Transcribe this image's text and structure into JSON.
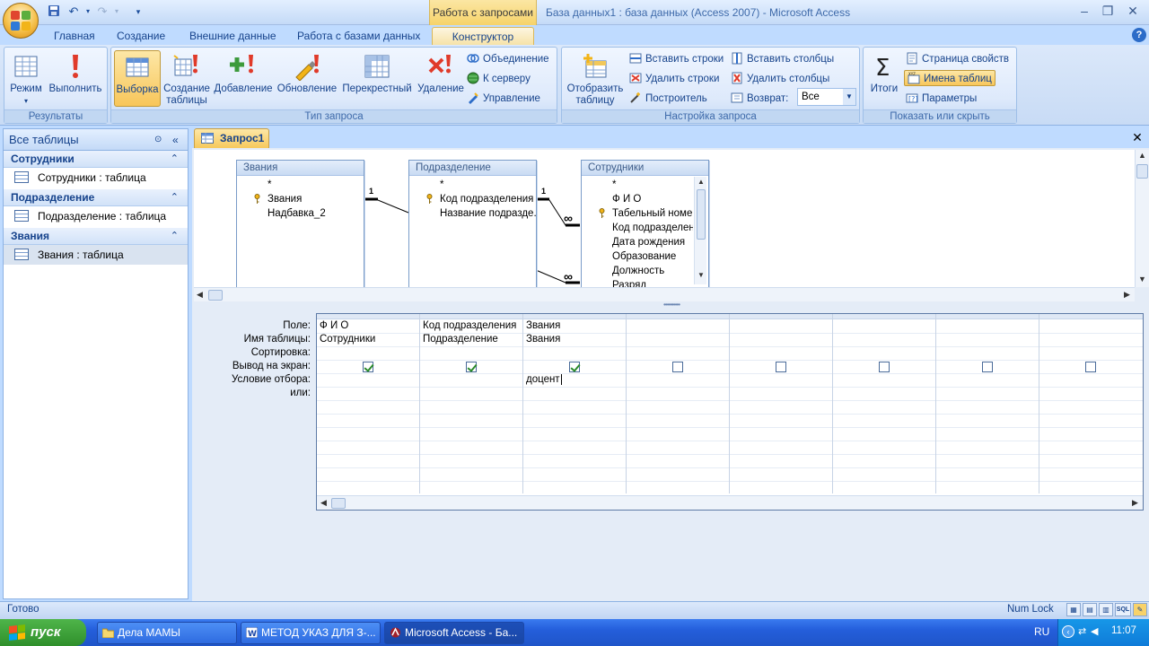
{
  "window": {
    "context_group": "Работа с запросами",
    "title": "База данных1 : база данных (Access 2007) - Microsoft Access"
  },
  "ribbon_tabs": [
    "Главная",
    "Создание",
    "Внешние данные",
    "Работа с базами данных",
    "Конструктор"
  ],
  "ribbon": {
    "results": {
      "label": "Результаты",
      "mode": "Режим",
      "run": "Выполнить"
    },
    "query_type": {
      "label": "Тип запроса",
      "select": "Выборка",
      "make_table_1": "Создание",
      "make_table_2": "таблицы",
      "append": "Добавление",
      "update": "Обновление",
      "crosstab": "Перекрестный",
      "delete": "Удаление",
      "union": "Объединение",
      "pass_through": "К серверу",
      "data_definition": "Управление"
    },
    "query_setup": {
      "label": "Настройка запроса",
      "show_table_1": "Отобразить",
      "show_table_2": "таблицу",
      "insert_rows": "Вставить строки",
      "delete_rows": "Удалить строки",
      "builder": "Построитель",
      "insert_columns": "Вставить столбцы",
      "delete_columns": "Удалить столбцы",
      "return_label": "Возврат:",
      "return_value": "Все"
    },
    "show_hide": {
      "label": "Показать или скрыть",
      "totals": "Итоги",
      "property_sheet": "Страница свойств",
      "table_names": "Имена таблиц",
      "parameters": "Параметры"
    }
  },
  "nav": {
    "header": "Все таблицы",
    "groups": [
      {
        "name": "Сотрудники",
        "item": "Сотрудники : таблица"
      },
      {
        "name": "Подразделение",
        "item": "Подразделение : таблица"
      },
      {
        "name": "Звания",
        "item": "Звания : таблица"
      }
    ]
  },
  "document": {
    "tab": "Запрос1"
  },
  "field_lists": [
    {
      "title": "Звания",
      "fields": [
        "*",
        "Звания",
        "Надбавка_2"
      ],
      "keys": [
        1
      ]
    },
    {
      "title": "Подразделение",
      "fields": [
        "*",
        "Код подразделения",
        "Название подразде."
      ],
      "keys": [
        1
      ]
    },
    {
      "title": "Сотрудники",
      "fields": [
        "*",
        "Ф И О",
        "Табельный номе",
        "Код подразделен",
        "Дата рождения",
        "Образование",
        "Должность",
        "Разряд"
      ],
      "keys": [
        2
      ]
    }
  ],
  "relationships": {
    "one": "1",
    "many": "∞"
  },
  "qbe": {
    "row_labels": [
      "Поле:",
      "Имя таблицы:",
      "Сортировка:",
      "Вывод на экран:",
      "Условие отбора:",
      "или:"
    ],
    "columns": [
      {
        "field": "Ф И О",
        "table": "Сотрудники",
        "show": true,
        "criteria": ""
      },
      {
        "field": "Код подразделения",
        "table": "Подразделение",
        "show": true,
        "criteria": ""
      },
      {
        "field": "Звания",
        "table": "Звания",
        "show": true,
        "criteria": "доцент"
      },
      {
        "field": "",
        "table": "",
        "show": false,
        "criteria": ""
      },
      {
        "field": "",
        "table": "",
        "show": false,
        "criteria": ""
      },
      {
        "field": "",
        "table": "",
        "show": false,
        "criteria": ""
      },
      {
        "field": "",
        "table": "",
        "show": false,
        "criteria": ""
      },
      {
        "field": "",
        "table": "",
        "show": false,
        "criteria": ""
      }
    ]
  },
  "status": {
    "text": "Готово",
    "numlock": "Num Lock",
    "sql": "SQL"
  },
  "taskbar": {
    "start": "пуск",
    "tasks": [
      "Дела МАМЫ",
      "МЕТОД УКАЗ ДЛЯ З-...",
      "Microsoft Access - Ба..."
    ],
    "lang": "RU",
    "clock": "11:07"
  }
}
